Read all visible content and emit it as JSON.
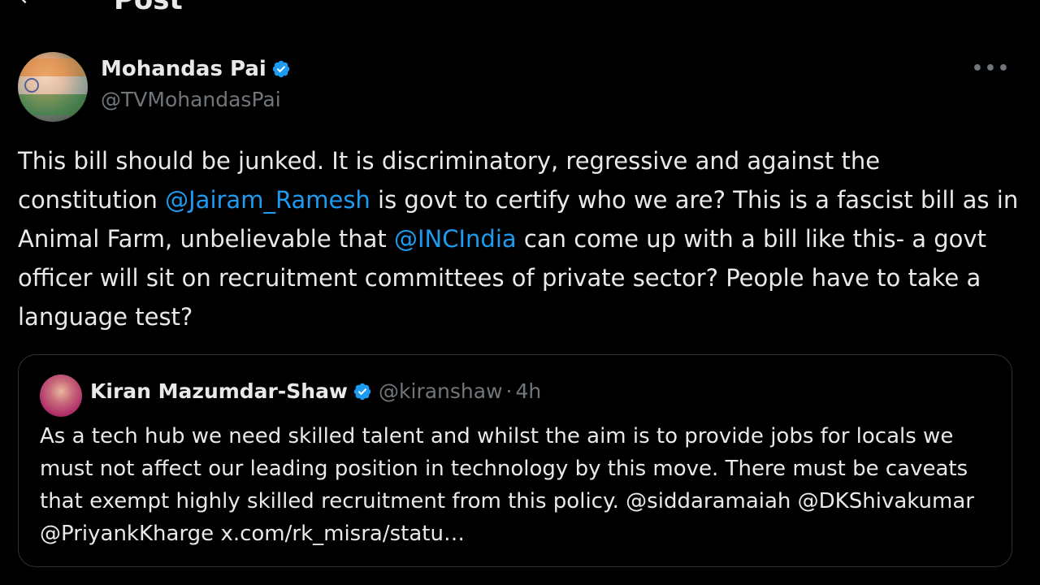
{
  "header": {
    "back_icon": "arrow-left-icon",
    "title": "Post"
  },
  "tweet": {
    "author_name": "Mohandas Pai",
    "author_handle": "@TVMohandasPai",
    "verified_icon": "verified-badge-icon",
    "more_icon": "more-horizontal-icon",
    "more_label": "•••",
    "text_parts": [
      "This bill should be junked. It is discriminatory, regressive and against the constitution ",
      "@Jairam_Ramesh",
      " is govt to certify who we are? This is a fascist bill as in Animal Farm, unbelievable that ",
      "@INCIndia",
      " can come up with a bill like this- a govt officer will sit on recruitment committees of private sector? People have to take a language test?"
    ]
  },
  "quote": {
    "author_name": "Kiran Mazumdar-Shaw",
    "author_handle": "@kiranshaw",
    "separator": "·",
    "time": "4h",
    "text": "As a tech hub we need skilled talent and whilst the aim is to provide jobs for locals we must not affect our leading position in technology by this move. There must be caveats that exempt highly skilled recruitment from this policy. @siddaramaiah @DKShivakumar @PriyankKharge x.com/rk_misra/statu…"
  },
  "colors": {
    "background": "#000000",
    "text": "#e7e9ea",
    "secondary_text": "#71767b",
    "accent": "#1d9bf0",
    "border": "#2f3336"
  }
}
